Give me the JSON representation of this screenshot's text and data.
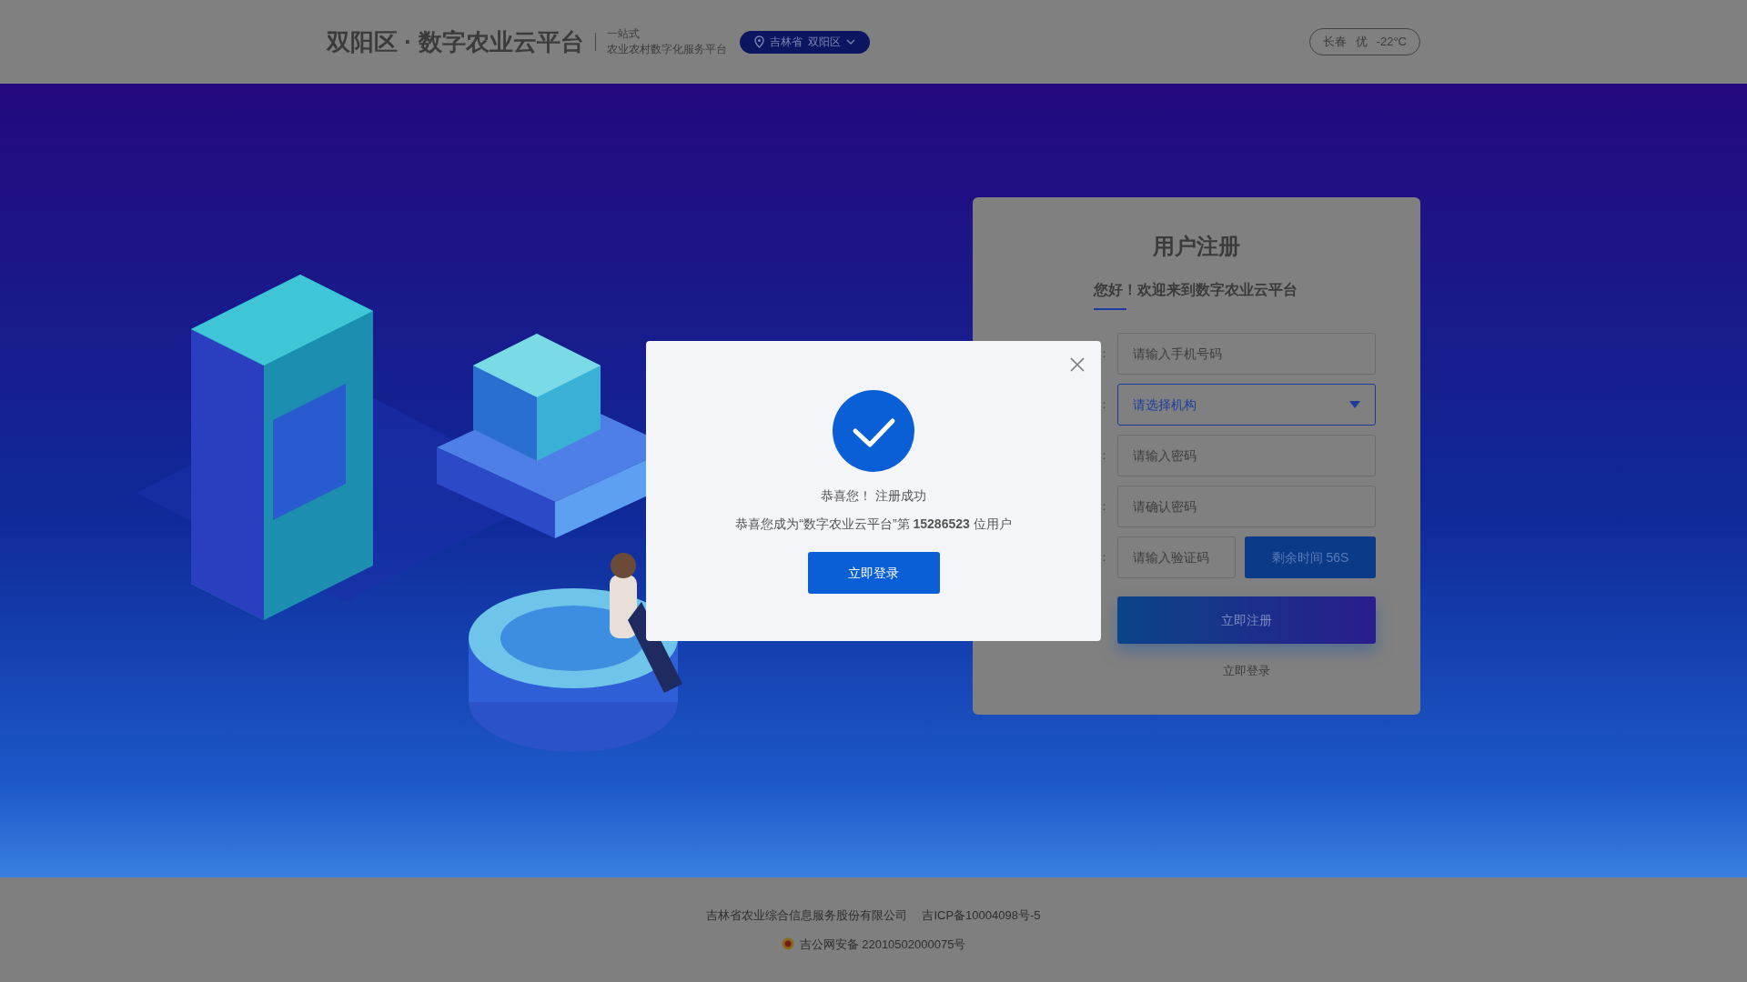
{
  "header": {
    "title": "双阳区 · 数字农业云平台",
    "tagline": [
      "一站式",
      "农业农村数字化服务平台"
    ],
    "location": {
      "province": "吉林省",
      "district": "双阳区"
    },
    "weather": {
      "city": "长春",
      "quality": "优",
      "temperature": "-22°C"
    }
  },
  "register_form": {
    "title": "用户注册",
    "subtitle": "您好！欢迎来到数字农业云平台",
    "fields": [
      {
        "kind": "input",
        "separator": "：",
        "placeholder": "请输入手机号码"
      },
      {
        "kind": "select",
        "separator": "：",
        "placeholder": "请选择机构"
      },
      {
        "kind": "input",
        "separator": "：",
        "placeholder": "请输入密码"
      },
      {
        "kind": "input",
        "separator": "：",
        "placeholder": "请确认密码"
      },
      {
        "kind": "code",
        "separator": "：",
        "placeholder": "请输入验证码",
        "button": "剩余时间 56S"
      }
    ],
    "submit": "立即注册",
    "login_link": "立即登录"
  },
  "dialog": {
    "title": "恭喜您！ 注册成功",
    "message": "恭喜您成为“数字农业云平台”第 **15286523** 位用户",
    "button": "立即登录"
  },
  "footer": {
    "company": "吉林省农业综合信息服务股份有限公司",
    "icp": "吉ICP备10004098号-5",
    "police_record": "吉公网安备 22010502000075号"
  }
}
